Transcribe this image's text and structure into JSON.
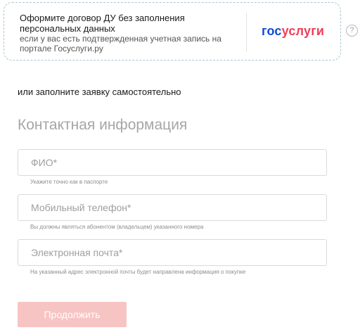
{
  "gosuslugi_card": {
    "title": "Оформите договор ДУ без заполнения персональных данных",
    "subtitle": "если у вас есть подтвержденная учетная запись на портале Госуслуги.ру",
    "logo_part1": "гос",
    "logo_part2": "услуги",
    "help_icon": "?"
  },
  "or_text": "или заполните заявку самостоятельно",
  "section_title": "Контактная информация",
  "fields": [
    {
      "placeholder": "ФИО*",
      "value": "",
      "hint": "Укажите точно как в паспорте"
    },
    {
      "placeholder": "Мобильный телефон*",
      "value": "",
      "hint": "Вы должны являться абонентом (владельцем) указанного номера"
    },
    {
      "placeholder": "Электронная почта*",
      "value": "",
      "hint": "На указанный адрес электронной почты будет направлена информация о покупке"
    }
  ],
  "submit_label": "Продолжить",
  "colors": {
    "gosuslugi_blue": "#0d4cd3",
    "gosuslugi_red": "#ee3f58",
    "submit_disabled": "#f7c4c4"
  }
}
